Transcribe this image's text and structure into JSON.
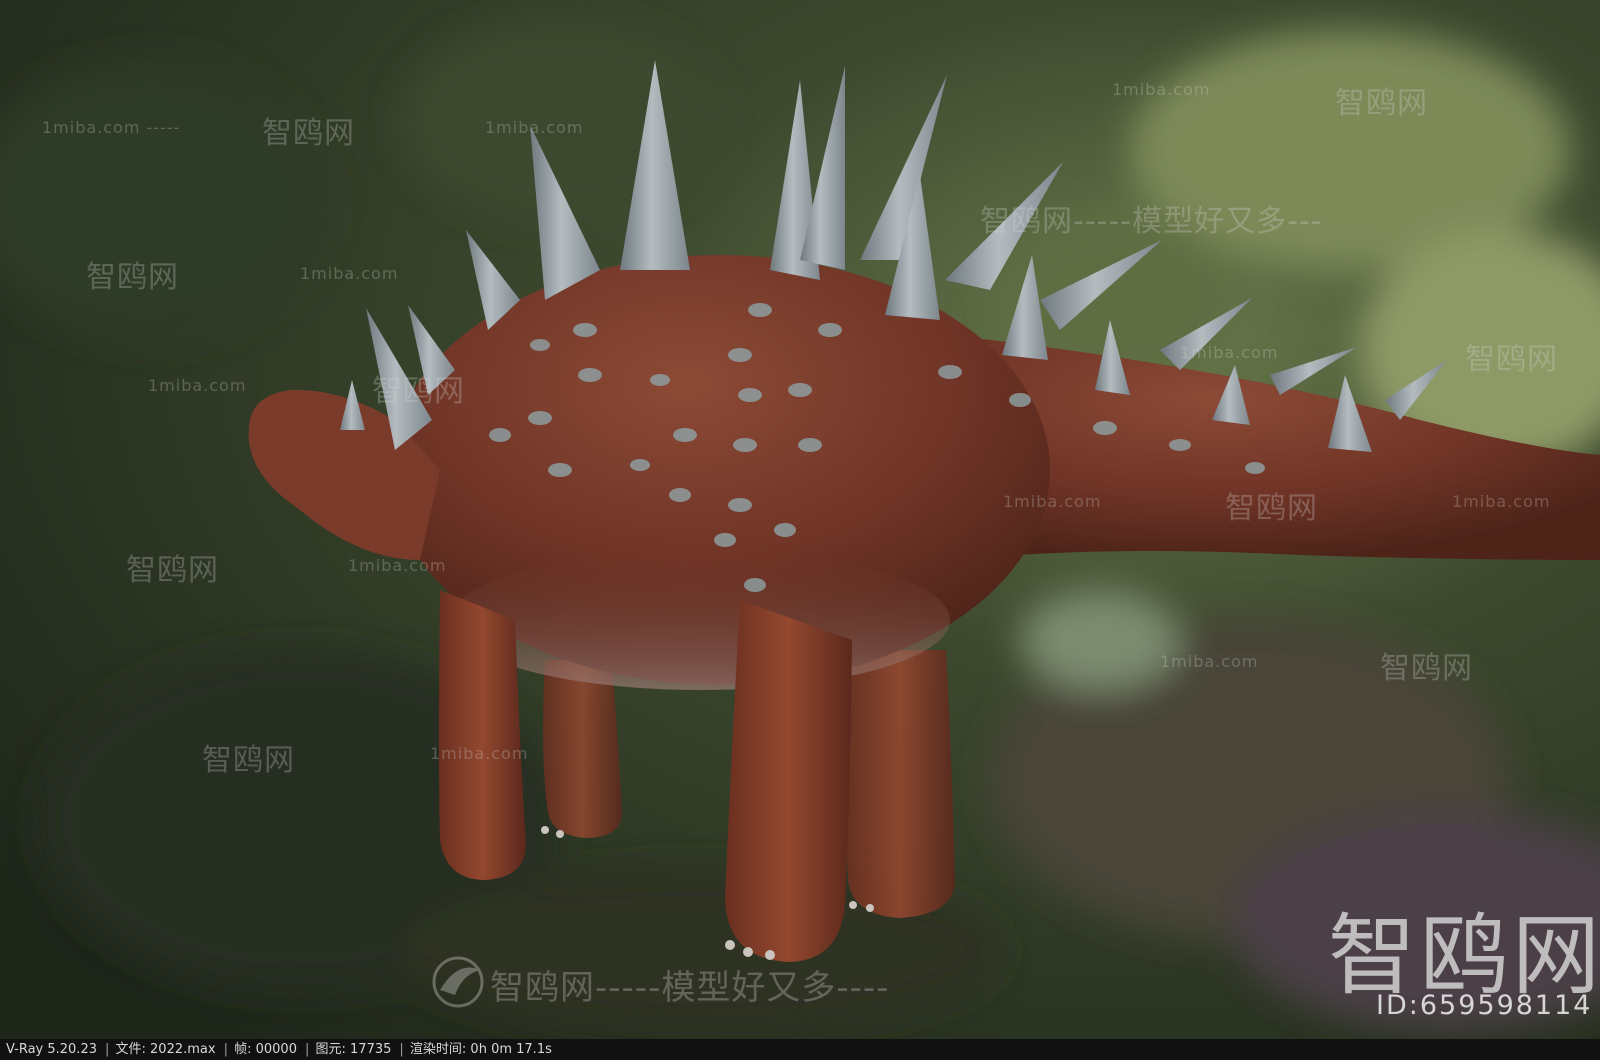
{
  "watermarks": {
    "site": "1miba.com",
    "brand": "智鸥网",
    "brand_slogan": "智鸥网-----模型好又多---",
    "bottom_slogan": "智鸥网-----模型好又多----",
    "big_logo": "智鸥网",
    "model_id": "ID:659598114"
  },
  "statusbar": {
    "renderer": "V-Ray 5.20.23",
    "file": "文件: 2022.max",
    "frame": "帧: 00000",
    "primitives": "图元: 17735",
    "render_time": "渲染时间:  0h  0m 17.1s"
  },
  "colors": {
    "skin": "#7a3a2a",
    "spikes": "#9aa4aa",
    "background": "#2b3423"
  }
}
